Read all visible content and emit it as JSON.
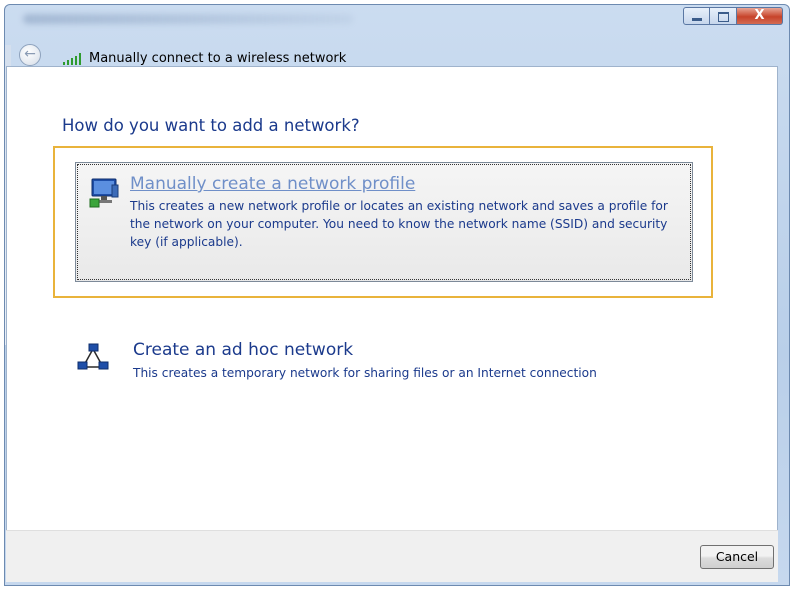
{
  "window": {
    "close_glyph": "X"
  },
  "nav": {
    "back_glyph": "←",
    "title": "Manually connect to a wireless network"
  },
  "main": {
    "heading": "How do you want to add a network?",
    "options": [
      {
        "title": "Manually create a network profile",
        "description": "This creates a new network profile or locates an existing network and saves a profile for the network on your computer. You need to know the network name (SSID) and security key (if applicable).",
        "icon": "network-profile-icon"
      },
      {
        "title": "Create an ad hoc network",
        "description": "This creates a temporary network for sharing files or an Internet connection",
        "icon": "ad-hoc-network-icon"
      }
    ]
  },
  "footer": {
    "cancel_label": "Cancel"
  },
  "colors": {
    "heading_blue": "#1b3a8c",
    "selection_border": "#e9b33b",
    "option_title_selected": "#6f8fc8",
    "option_title_normal": "#1b3a8c"
  }
}
